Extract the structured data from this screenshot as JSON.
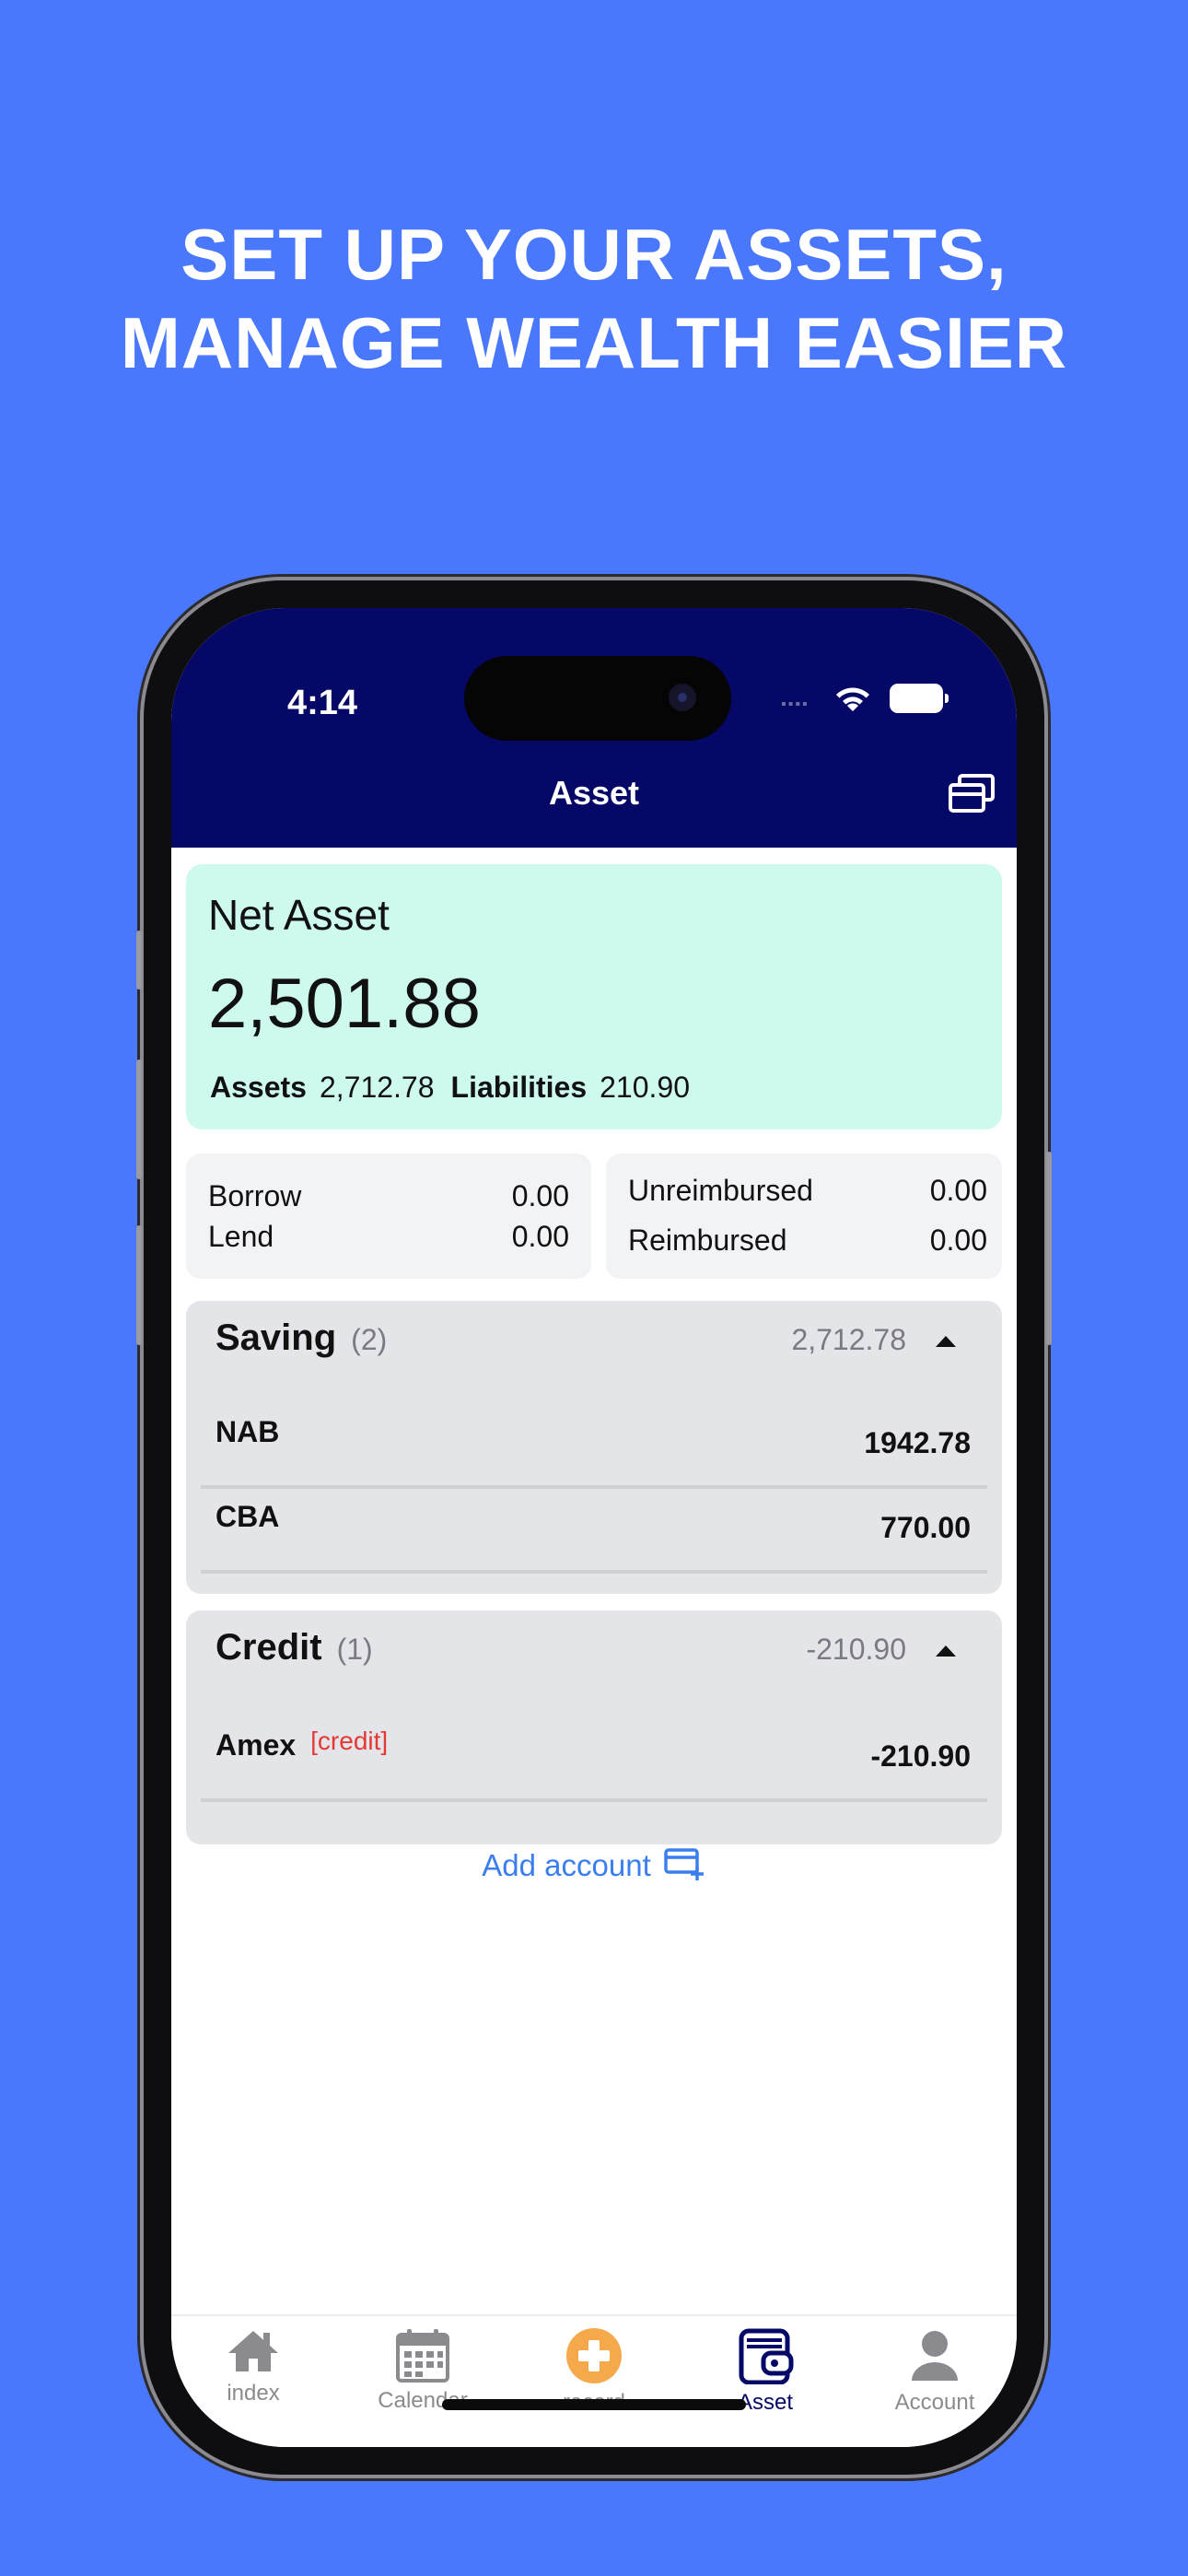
{
  "headline": {
    "line1": "SET UP YOUR ASSETS,",
    "line2": "MANAGE WEALTH EASIER"
  },
  "status_bar": {
    "time": "4:14"
  },
  "nav": {
    "title": "Asset",
    "action_icon": "cards-stack-icon"
  },
  "net_asset": {
    "title": "Net Asset",
    "value": "2,501.88",
    "assets_label": "Assets",
    "assets_value": "2,712.78",
    "liabilities_label": "Liabilities",
    "liabilities_value": "210.90"
  },
  "loans": {
    "borrow_label": "Borrow",
    "borrow_value": "0.00",
    "lend_label": "Lend",
    "lend_value": "0.00"
  },
  "reimburse": {
    "unreimbursed_label": "Unreimbursed",
    "unreimbursed_value": "0.00",
    "reimbursed_label": "Reimbursed",
    "reimbursed_value": "0.00"
  },
  "groups": [
    {
      "name": "Saving",
      "count": "(2)",
      "total": "2,712.78",
      "accounts": [
        {
          "name": "NAB",
          "amount": "1942.78"
        },
        {
          "name": "CBA",
          "amount": "770.00"
        }
      ]
    },
    {
      "name": "Credit",
      "count": "(1)",
      "total": "-210.90",
      "accounts": [
        {
          "name": "Amex",
          "tag": "[credit]",
          "amount": "-210.90"
        }
      ]
    }
  ],
  "add_account": {
    "label": "Add account",
    "icon": "card-add-icon"
  },
  "tabs": [
    {
      "label": "index",
      "icon": "home-icon"
    },
    {
      "label": "Calendar",
      "icon": "calendar-icon"
    },
    {
      "label": "record",
      "icon": "plus-circle-icon"
    },
    {
      "label": "Asset",
      "icon": "wallet-icon",
      "active": true
    },
    {
      "label": "Account",
      "icon": "user-icon"
    }
  ],
  "colors": {
    "background": "#4a78fc",
    "nav": "#050866",
    "net_card": "#cdf9ef",
    "accent_orange": "#f6a94a",
    "link_blue": "#3b7ef0",
    "credit_red": "#e53935"
  }
}
